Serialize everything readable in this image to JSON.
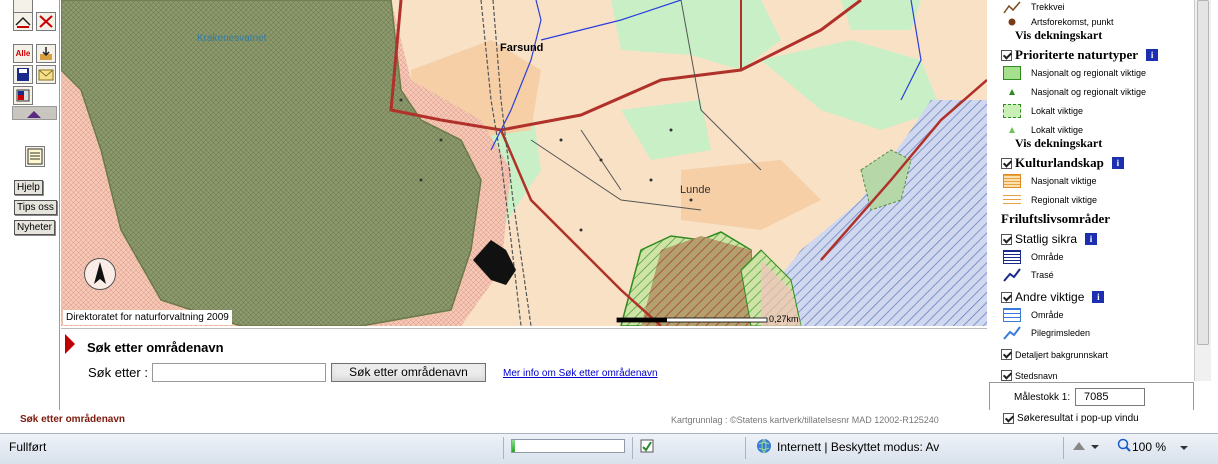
{
  "toolbar": {
    "help_label": "Hjelp",
    "tips_label": "Tips oss",
    "news_label": "Nyheter",
    "all_label": "Alle"
  },
  "map": {
    "lake_label": "Krakenesvatnet",
    "place_farsund": "Farsund",
    "place_lunde": "Lunde",
    "credit": "Direktoratet for naturforvaltning 2009",
    "scale_bar_label": "0,27km"
  },
  "legend": {
    "item_trekkvei": "Trekkvei",
    "item_artsforekomst": "Artsforekomst, punkt",
    "vis_dekningskart_1": "Vis dekningskart",
    "head_prioriterte": "Prioriterte naturtyper",
    "item_nasj_reg_1": "Nasjonalt og regionalt viktige",
    "item_nasj_reg_2": "Nasjonalt og regionalt viktige",
    "item_lokalt_1": "Lokalt viktige",
    "item_lokalt_2": "Lokalt viktige",
    "vis_dekningskart_2": "Vis dekningskart",
    "head_kultur": "Kulturlandskap",
    "item_nasj_viktige": "Nasjonalt viktige",
    "item_reg_viktige": "Regionalt viktige",
    "head_friluft": "Friluftslivsområder",
    "head_statlig": "Statlig sikra",
    "item_omrade_1": "Område",
    "item_trase": "Trasé",
    "head_andre": "Andre viktige",
    "item_omrade_2": "Område",
    "item_pilegrim": "Pilegrimsleden",
    "detail_bg": "Detaljert bakgrunnskart",
    "stedsnavn": "Stedsnavn",
    "info_glyph": "i"
  },
  "scale": {
    "label": "Målestokk 1:",
    "value": "7085"
  },
  "search": {
    "title": "Søk etter områdenavn",
    "label": "Søk etter :",
    "input_value": "",
    "button_label": "Søk etter områdenavn",
    "link_text": "Mer info om Søk etter områdenavn"
  },
  "footer": {
    "search_title": "Søk etter områdenavn",
    "copyright": "Kartgrunnlag : ©Statens kartverk/tillatelsesnr MAD 12002-R125240",
    "popup_label": "Søkeresultat i pop-up vindu"
  },
  "statusbar": {
    "status": "Fullført",
    "zone": "Internett | Beskyttet modus: Av",
    "zoom": "100 %",
    "progress": 0.03
  },
  "colors": {
    "farmland": "#f9e1c6",
    "forest_dark": "#8b9a6a",
    "water": "#a9c9ef",
    "road": "#b0312a"
  }
}
